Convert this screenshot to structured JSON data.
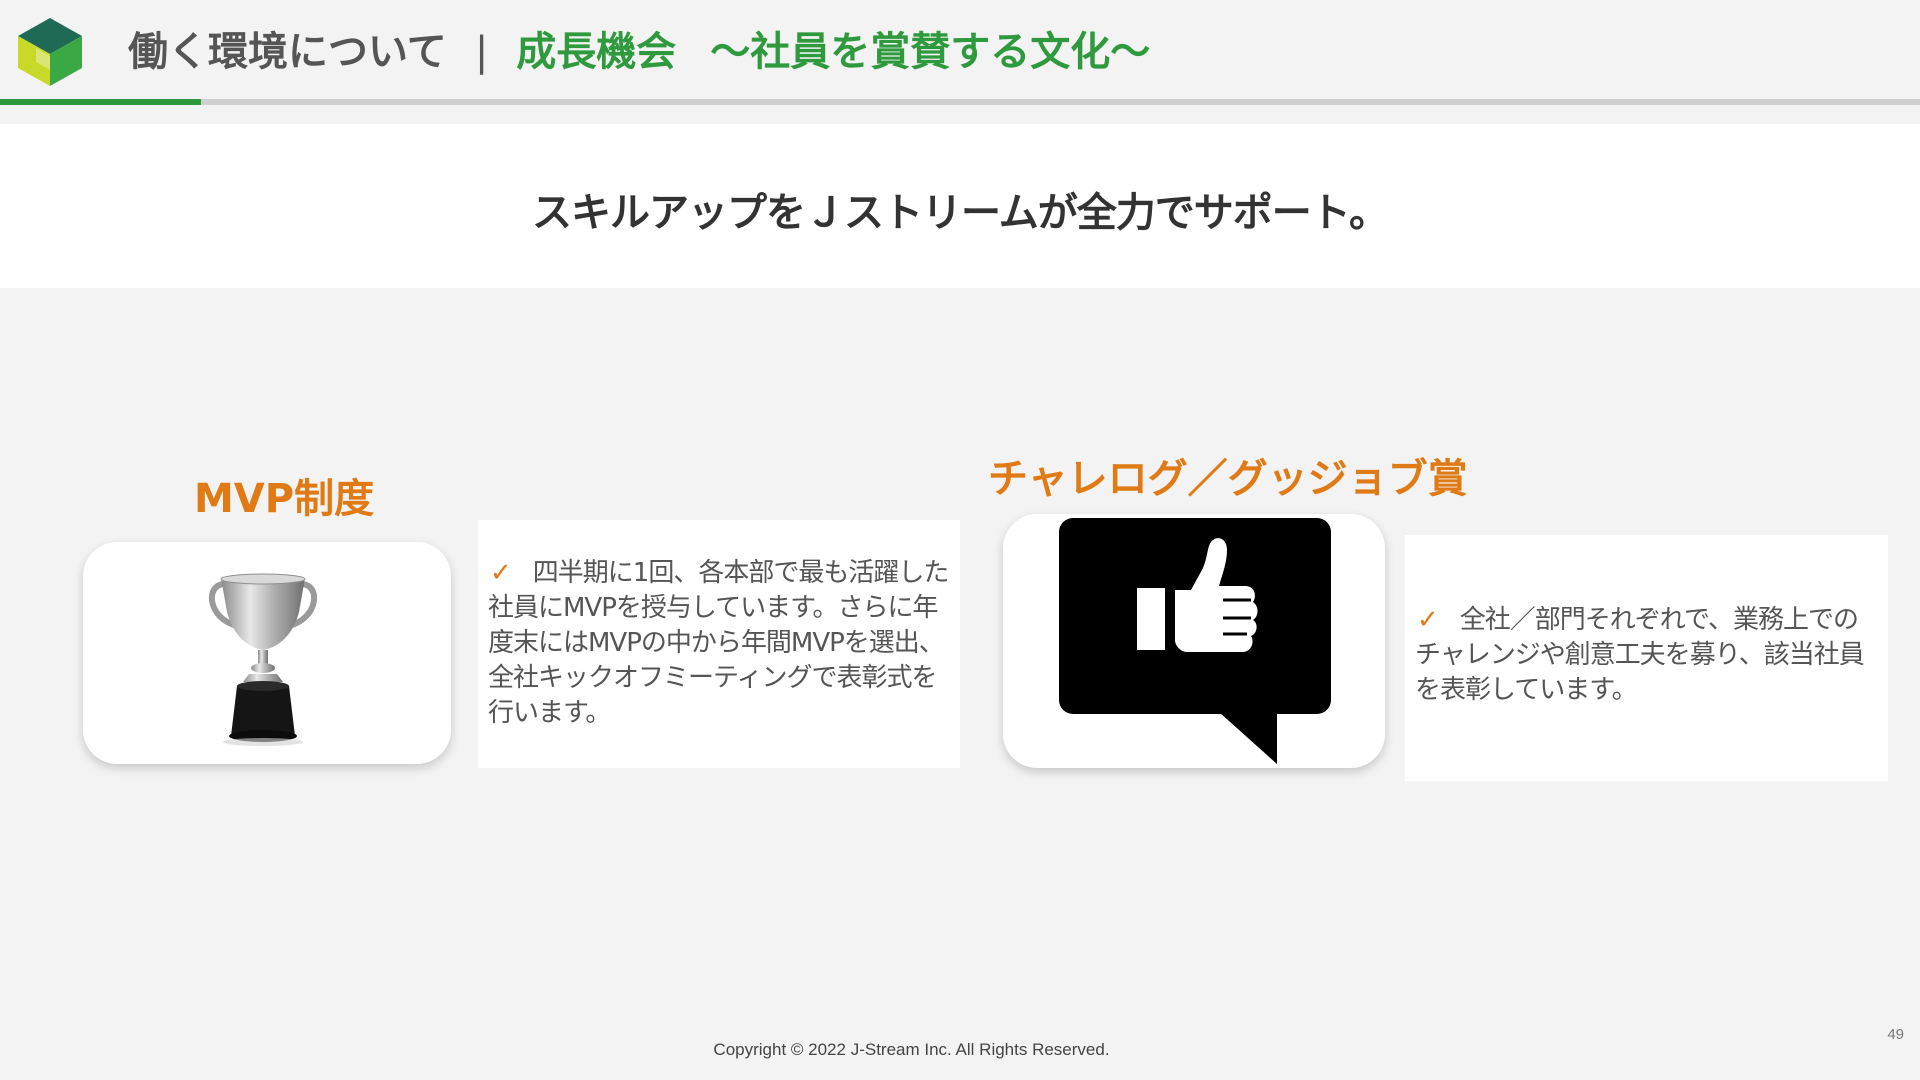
{
  "header": {
    "title_main": "働く環境について",
    "separator": "|",
    "title_category": "成長機会",
    "title_sub": "～社員を賞賛する文化～"
  },
  "banner": {
    "text": "スキルアップをＪストリームが全力でサポート。"
  },
  "mvp": {
    "heading": "MVP制度",
    "check": "✓",
    "body": "四半期に1回、各本部で最も活躍した社員にMVPを授与しています。さらに年度末にはMVPの中から年間MVPを選出、全社キックオフミーティングで表彰式を行います。",
    "image_icon": "trophy-icon"
  },
  "challenge": {
    "heading": "チャレログ／グッジョブ賞",
    "check": "✓",
    "body": "全社／部門それぞれで、業務上でのチャレンジや創意工夫を募り、該当社員を表彰しています。",
    "image_icon": "thumbs-up-speech-bubble-icon"
  },
  "footer": {
    "copyright": "Copyright © 2022 J-Stream Inc. All Rights Reserved.",
    "page_number": "49"
  },
  "colors": {
    "accent_green": "#2e9a3d",
    "accent_orange": "#e07a14",
    "background": "#f3f3f3"
  }
}
